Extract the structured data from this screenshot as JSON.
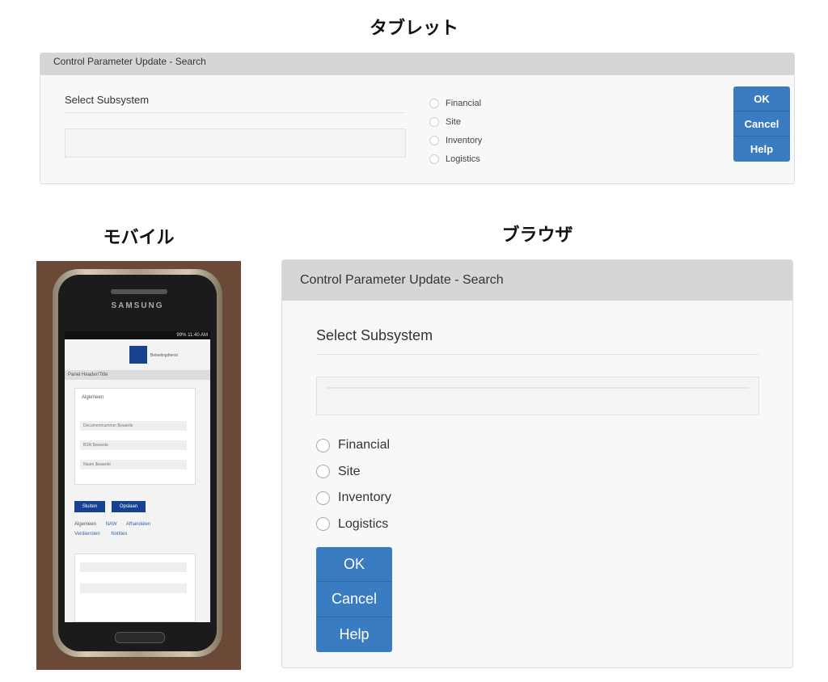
{
  "captions": {
    "tablet": "タブレット",
    "mobile": "モバイル",
    "browser": "ブラウザ"
  },
  "tablet": {
    "title": "Control Parameter Update - Search",
    "select_label": "Select Subsystem",
    "input_value": "",
    "options": [
      "Financial",
      "Site",
      "Inventory",
      "Logistics"
    ],
    "buttons": {
      "ok": "OK",
      "cancel": "Cancel",
      "help": "Help"
    }
  },
  "mobile": {
    "brand": "SAMSUNG",
    "status": "99% 11:40 AM",
    "logo_text": "Belastingdienst",
    "panel_header": "Panel Header/Title",
    "section": "Algemeen",
    "fields": [
      "Documentnummer  $waarde",
      "BSN  $waarde",
      "Naam  $waarde"
    ],
    "buttons": [
      "Sluiten",
      "Opslaan"
    ],
    "tabs": [
      "Algemeen",
      "NAW",
      "Afhandelen",
      "Verdiensten",
      "Notities"
    ]
  },
  "browser": {
    "title": "Control Parameter Update - Search",
    "select_label": "Select Subsystem",
    "input_value": "",
    "options": [
      "Financial",
      "Site",
      "Inventory",
      "Logistics"
    ],
    "buttons": {
      "ok": "OK",
      "cancel": "Cancel",
      "help": "Help"
    }
  },
  "colors": {
    "header_gray": "#d6d6d6",
    "button_blue": "#3a7cc2",
    "panel_bg": "#f8f8f8"
  }
}
